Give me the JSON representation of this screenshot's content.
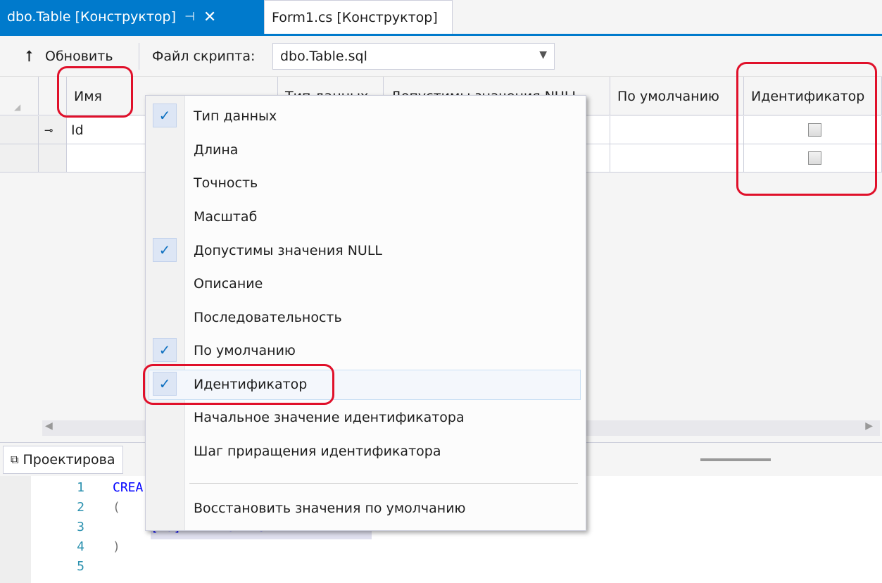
{
  "tabs": {
    "active_title": "dbo.Table [Конструктор]",
    "active_pin": "⊣",
    "active_close": "✕",
    "inactive_title": "Form1.cs [Конструктор]"
  },
  "toolbar": {
    "refresh_label": "Обновить",
    "script_label": "Файл скрипта:",
    "script_value": "dbo.Table.sql"
  },
  "grid": {
    "headers": [
      "Имя",
      "Тип данных",
      "Допустимы значения NULL",
      "По умолчанию",
      "Идентификатор"
    ],
    "rows": [
      {
        "name": "Id",
        "is_key": true,
        "identity_checked": false
      },
      {
        "name": "",
        "is_key": false,
        "identity_checked": false
      }
    ]
  },
  "design_tab": {
    "label": "Проектирова"
  },
  "editor": {
    "line_numbers": [
      "1",
      "2",
      "3",
      "4",
      "5"
    ],
    "lines": [
      "CREA",
      "(",
      "[Id] INT NOT NULL PRIMARY KEY",
      ")",
      ""
    ]
  },
  "context_menu": {
    "items": [
      {
        "label": "Тип данных",
        "checked": true
      },
      {
        "label": "Длина",
        "checked": false
      },
      {
        "label": "Точность",
        "checked": false
      },
      {
        "label": "Масштаб",
        "checked": false
      },
      {
        "label": "Допустимы значения NULL",
        "checked": true
      },
      {
        "label": "Описание",
        "checked": false
      },
      {
        "label": "Последовательность",
        "checked": false
      },
      {
        "label": "По умолчанию",
        "checked": true
      },
      {
        "label": "Идентификатор",
        "checked": true
      },
      {
        "label": "Начальное значение идентификатора",
        "checked": false
      },
      {
        "label": "Шаг приращения идентификатора",
        "checked": false
      }
    ],
    "reset_label": "Восстановить значения по умолчанию",
    "check_glyph": "✓"
  },
  "colors": {
    "accent": "#007acc",
    "annotation_red": "#e0102a",
    "keyword_blue": "#0000ff",
    "line_number": "#2b91af"
  },
  "icons": {
    "refresh": "up-arrow-icon",
    "key": "primary-key-icon",
    "design": "design-view-icon",
    "dropdown": "chevron-down-icon"
  }
}
